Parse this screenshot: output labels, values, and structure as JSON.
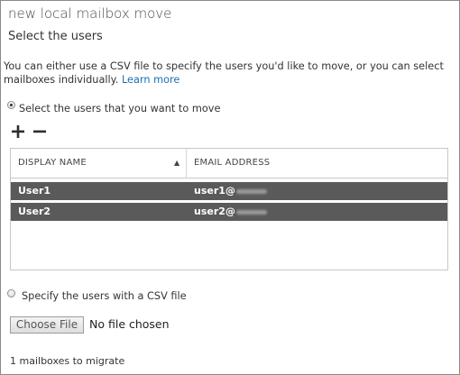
{
  "header": {
    "title": "new local mailbox move",
    "subtitle": "Select the users"
  },
  "description": {
    "text": "You can either use a CSV file to specify the users you'd like to move, or you can select mailboxes individually.",
    "link": "Learn more"
  },
  "option_select": {
    "label": "Select the users that you want to move",
    "checked": true
  },
  "toolbar": {
    "add_icon": "plus-icon",
    "remove_icon": "minus-icon"
  },
  "table": {
    "columns": [
      "DISPLAY NAME",
      "EMAIL ADDRESS"
    ],
    "sort_indicator": "▲",
    "rows": [
      {
        "display_name": "User1",
        "email": "user1@"
      },
      {
        "display_name": "User2",
        "email": "user2@"
      }
    ]
  },
  "option_csv": {
    "label": "Specify the users with a CSV file",
    "checked": false
  },
  "file_input": {
    "button_label": "Choose File",
    "status": "No file chosen"
  },
  "footer": {
    "count_text": "1 mailboxes to migrate"
  },
  "colors": {
    "link": "#1a6fb4",
    "selected_row": "#5a5a5a"
  }
}
